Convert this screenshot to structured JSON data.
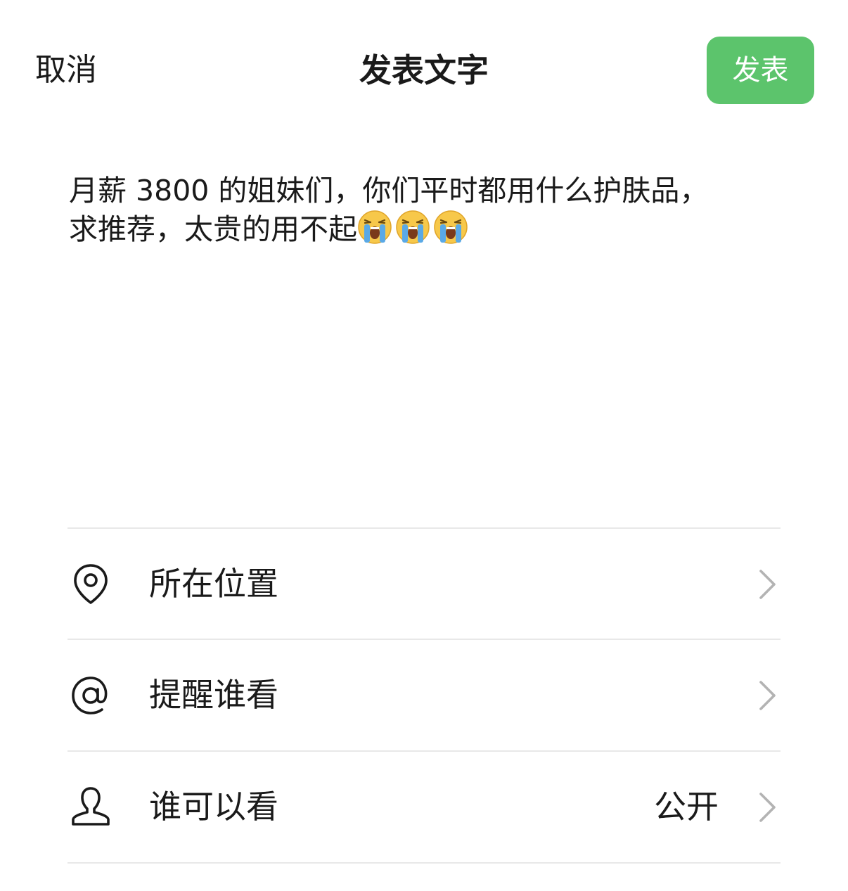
{
  "header": {
    "cancel_label": "取消",
    "title": "发表文字",
    "publish_label": "发表",
    "publish_color": "#5cc46c"
  },
  "post": {
    "line1": "月薪 3800 的姐妹们，你们平时都用什么护肤品，",
    "line2": "求推荐，太贵的用不起",
    "emojis": [
      "loudly-crying-face-icon",
      "loudly-crying-face-icon",
      "loudly-crying-face-icon"
    ]
  },
  "options": [
    {
      "icon": "location-pin-icon",
      "label": "所在位置",
      "value": ""
    },
    {
      "icon": "at-sign-icon",
      "label": "提醒谁看",
      "value": ""
    },
    {
      "icon": "person-icon",
      "label": "谁可以看",
      "value": "公开"
    }
  ]
}
